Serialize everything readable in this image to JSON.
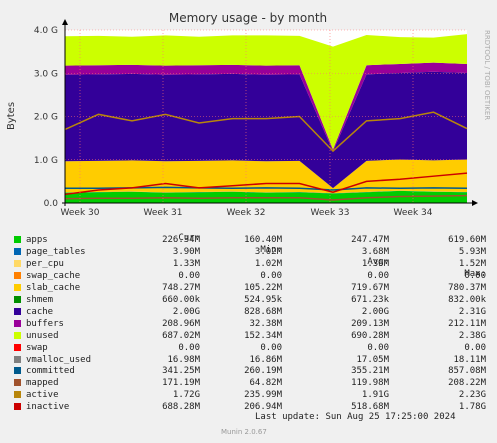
{
  "title": "Memory usage - by month",
  "side_label": "RRDTOOL / TOBI OETIKER",
  "munin_version": "Munin 2.0.67",
  "last_update": "Last update: Sun Aug 25 17:25:00 2024",
  "legend_headers": [
    "Cur:",
    "Min:",
    "Avg:",
    "Max:"
  ],
  "legend": [
    {
      "name": "apps",
      "color": "#00cc00",
      "cur": "226.34M",
      "min": "160.40M",
      "avg": "247.47M",
      "max": "619.60M"
    },
    {
      "name": "page_tables",
      "color": "#0066b3",
      "cur": "3.90M",
      "min": "3.02M",
      "avg": "3.68M",
      "max": "5.93M"
    },
    {
      "name": "per_cpu",
      "color": "#ffd966",
      "cur": "1.33M",
      "min": "1.02M",
      "avg": "1.36M",
      "max": "1.52M"
    },
    {
      "name": "swap_cache",
      "color": "#ff8000",
      "cur": "0.00",
      "min": "0.00",
      "avg": "0.00",
      "max": "0.00"
    },
    {
      "name": "slab_cache",
      "color": "#ffcc00",
      "cur": "748.27M",
      "min": "105.22M",
      "avg": "719.67M",
      "max": "780.37M"
    },
    {
      "name": "shmem",
      "color": "#008f00",
      "cur": "660.00k",
      "min": "524.95k",
      "avg": "671.23k",
      "max": "832.00k"
    },
    {
      "name": "cache",
      "color": "#330099",
      "cur": "2.00G",
      "min": "828.68M",
      "avg": "2.00G",
      "max": "2.31G"
    },
    {
      "name": "buffers",
      "color": "#990099",
      "cur": "208.96M",
      "min": "32.38M",
      "avg": "209.13M",
      "max": "212.11M"
    },
    {
      "name": "unused",
      "color": "#ccff00",
      "cur": "687.02M",
      "min": "152.34M",
      "avg": "690.28M",
      "max": "2.38G"
    },
    {
      "name": "swap",
      "color": "#ff0000",
      "cur": "0.00",
      "min": "0.00",
      "avg": "0.00",
      "max": "0.00"
    },
    {
      "name": "vmalloc_used",
      "color": "#808080",
      "cur": "16.98M",
      "min": "16.86M",
      "avg": "17.05M",
      "max": "18.11M"
    },
    {
      "name": "committed",
      "color": "#005a8c",
      "cur": "341.25M",
      "min": "260.19M",
      "avg": "355.21M",
      "max": "857.08M"
    },
    {
      "name": "mapped",
      "color": "#a0522d",
      "cur": "171.19M",
      "min": "64.82M",
      "avg": "119.98M",
      "max": "208.22M"
    },
    {
      "name": "active",
      "color": "#b8860b",
      "cur": "1.72G",
      "min": "235.99M",
      "avg": "1.91G",
      "max": "2.23G"
    },
    {
      "name": "inactive",
      "color": "#cc0000",
      "cur": "688.28M",
      "min": "206.94M",
      "avg": "518.68M",
      "max": "1.78G"
    }
  ],
  "chart_data": {
    "type": "area",
    "title": "Memory usage - by month",
    "ylabel": "Bytes",
    "ylim": [
      0,
      4000000000
    ],
    "y_ticks": [
      "0.0",
      "1.0 G",
      "2.0 G",
      "3.0 G",
      "4.0 G"
    ],
    "x_ticks": [
      "Week 30",
      "Week 31",
      "Week 32",
      "Week 33",
      "Week 34"
    ],
    "grid": true,
    "stacked_series": [
      {
        "name": "apps",
        "values": [
          0.24,
          0.25,
          0.26,
          0.24,
          0.25,
          0.26,
          0.24,
          0.25,
          0.22,
          0.25,
          0.28,
          0.26,
          0.25
        ]
      },
      {
        "name": "page_tables",
        "values": [
          0.004,
          0.004,
          0.004,
          0.004,
          0.004,
          0.004,
          0.004,
          0.004,
          0.004,
          0.004,
          0.004,
          0.004,
          0.004
        ]
      },
      {
        "name": "per_cpu",
        "values": [
          0.001,
          0.001,
          0.001,
          0.001,
          0.001,
          0.001,
          0.001,
          0.001,
          0.001,
          0.001,
          0.001,
          0.001,
          0.001
        ]
      },
      {
        "name": "slab_cache",
        "values": [
          0.72,
          0.72,
          0.72,
          0.72,
          0.72,
          0.72,
          0.72,
          0.72,
          0.12,
          0.72,
          0.72,
          0.72,
          0.75
        ]
      },
      {
        "name": "cache",
        "values": [
          2.0,
          2.0,
          2.0,
          2.0,
          2.0,
          2.0,
          2.0,
          2.0,
          0.85,
          2.0,
          2.0,
          2.05,
          2.0
        ]
      },
      {
        "name": "buffers",
        "values": [
          0.21,
          0.21,
          0.21,
          0.21,
          0.21,
          0.21,
          0.21,
          0.21,
          0.04,
          0.21,
          0.21,
          0.21,
          0.21
        ]
      },
      {
        "name": "unused",
        "values": [
          0.68,
          0.68,
          0.65,
          0.7,
          0.66,
          0.68,
          0.7,
          0.68,
          2.38,
          0.7,
          0.62,
          0.58,
          0.69
        ]
      }
    ],
    "line_series": [
      {
        "name": "committed",
        "values": [
          0.34,
          0.34,
          0.35,
          0.36,
          0.35,
          0.34,
          0.35,
          0.34,
          0.3,
          0.35,
          0.34,
          0.35,
          0.34
        ]
      },
      {
        "name": "mapped",
        "values": [
          0.1,
          0.11,
          0.11,
          0.12,
          0.11,
          0.12,
          0.12,
          0.12,
          0.07,
          0.12,
          0.15,
          0.16,
          0.17
        ]
      },
      {
        "name": "active",
        "values": [
          1.7,
          2.05,
          1.9,
          2.05,
          1.85,
          1.95,
          1.95,
          2.0,
          1.2,
          1.9,
          1.95,
          2.1,
          1.72
        ]
      },
      {
        "name": "inactive",
        "values": [
          0.2,
          0.3,
          0.35,
          0.45,
          0.35,
          0.4,
          0.45,
          0.45,
          0.25,
          0.5,
          0.55,
          0.62,
          0.69
        ]
      }
    ]
  }
}
